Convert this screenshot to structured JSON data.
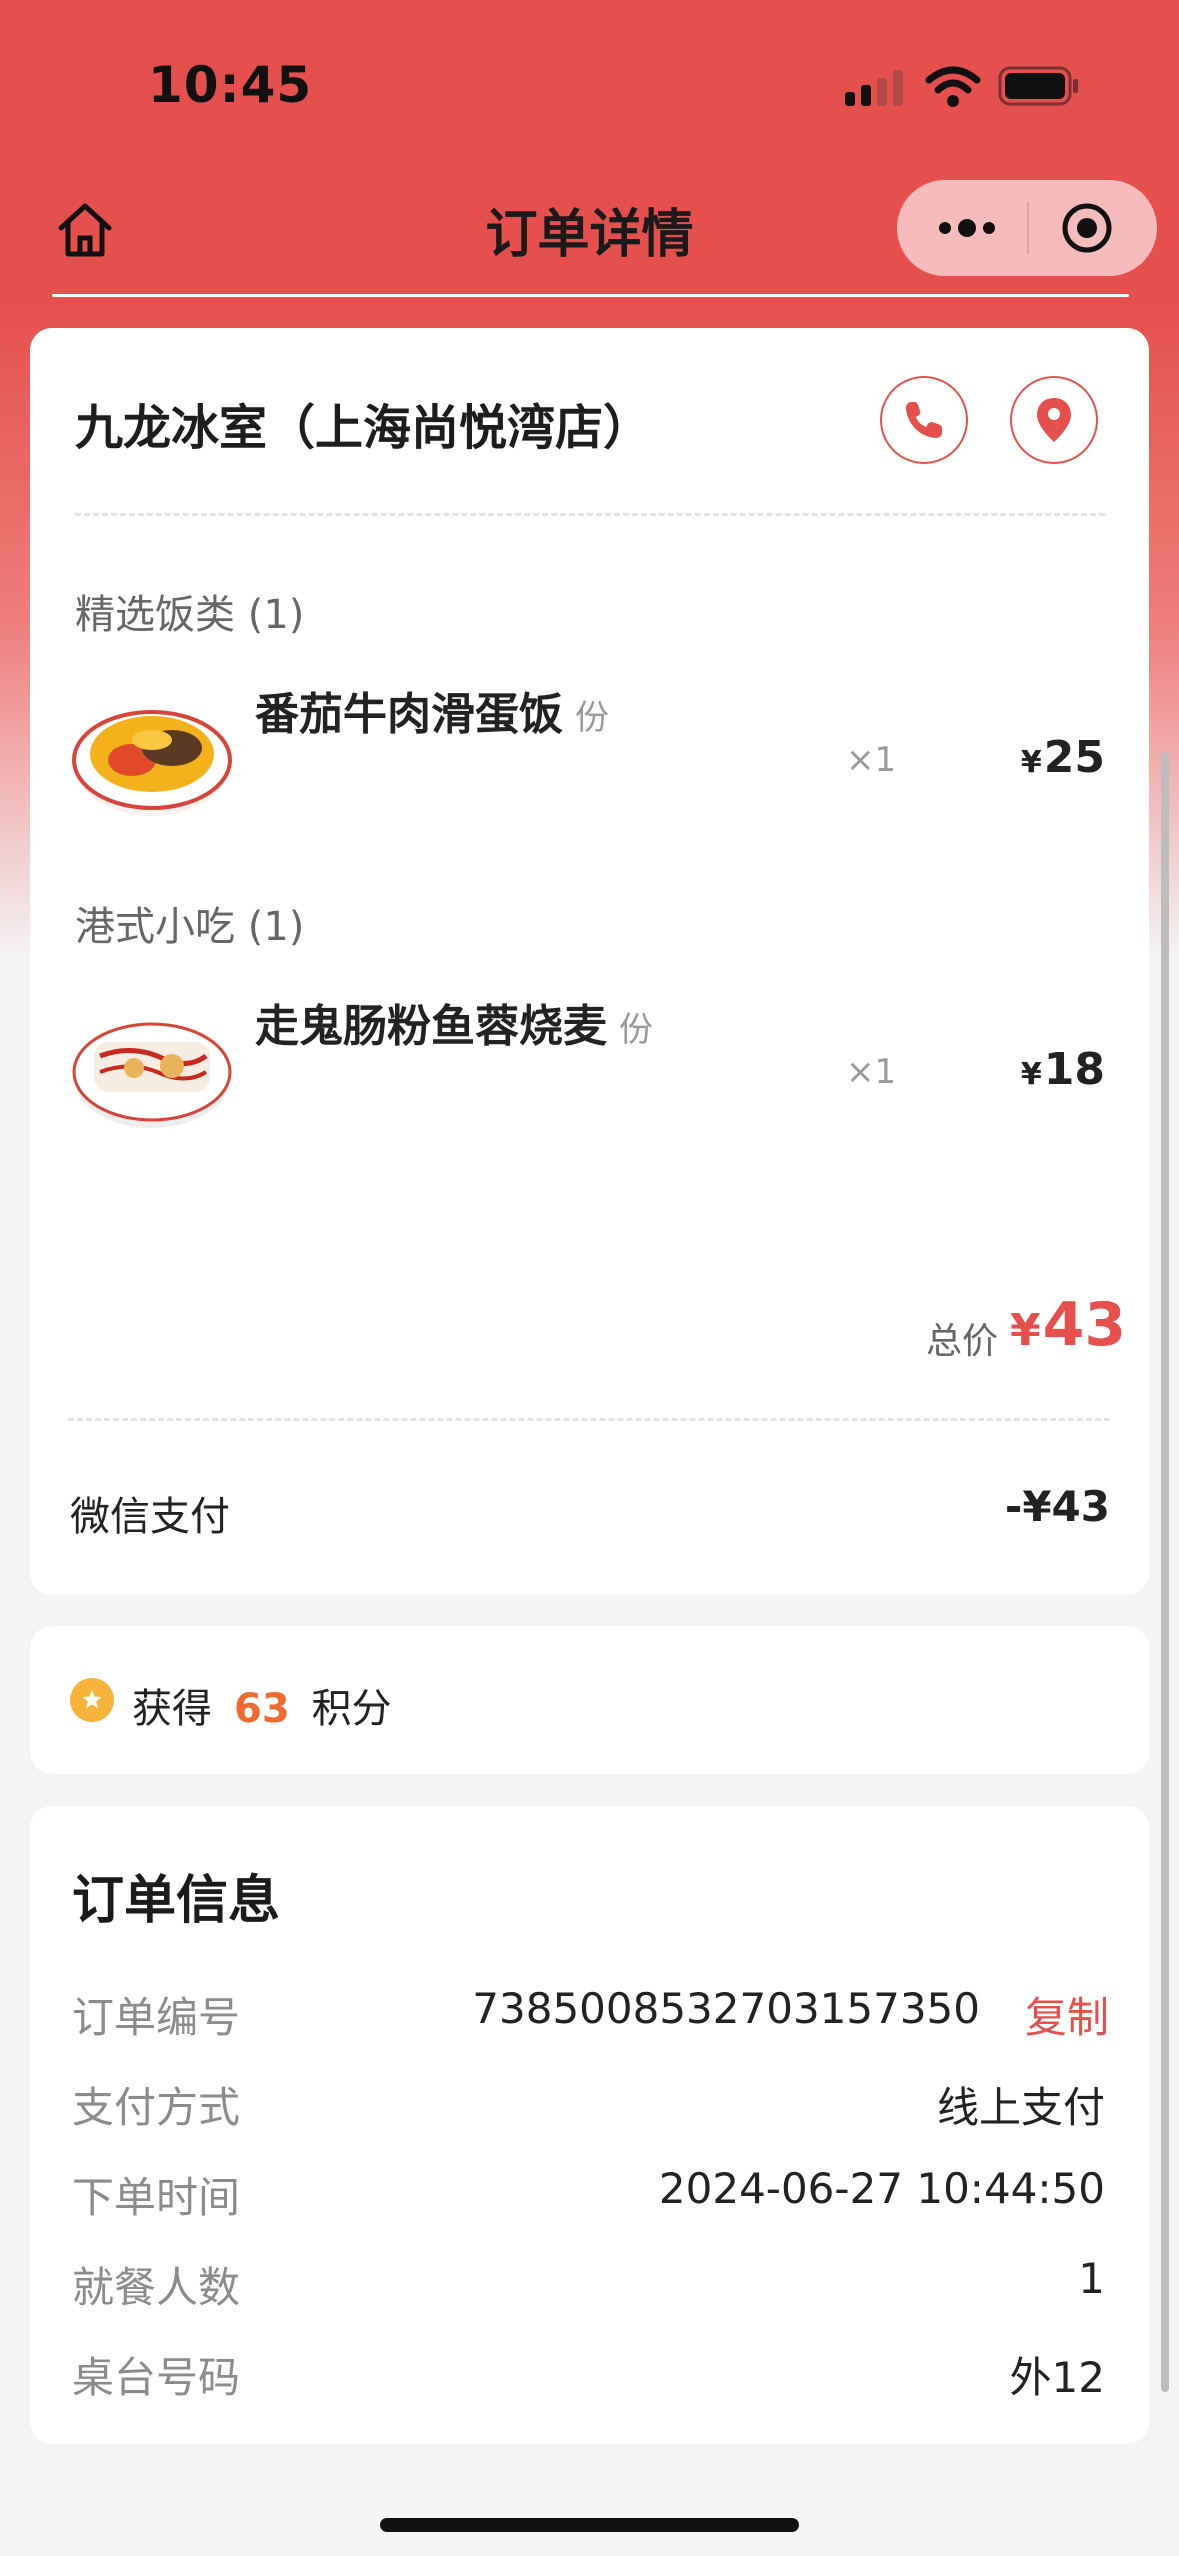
{
  "status_bar": {
    "time": "10:45"
  },
  "nav": {
    "title": "订单详情"
  },
  "store": {
    "name": "九龙冰室（上海尚悦湾店）"
  },
  "categories": [
    {
      "label": "精选饭类 (1)",
      "items": [
        {
          "name": "番茄牛肉滑蛋饭",
          "unit": "份",
          "qty": "×1",
          "currency": "¥",
          "price": "25"
        }
      ]
    },
    {
      "label": "港式小吃 (1)",
      "items": [
        {
          "name": "走鬼肠粉鱼蓉烧麦",
          "unit": "份",
          "qty": "×1",
          "currency": "¥",
          "price": "18"
        }
      ]
    }
  ],
  "total": {
    "label": "总价",
    "currency": "¥",
    "amount": "43"
  },
  "payment": {
    "label": "微信支付",
    "amount": "-¥43"
  },
  "points": {
    "prefix": "获得",
    "value": "63",
    "suffix": "积分"
  },
  "order_info": {
    "title": "订单信息",
    "copy_label": "复制",
    "rows": [
      {
        "label": "订单编号",
        "value": "7385008532703157350"
      },
      {
        "label": "支付方式",
        "value": "线上支付"
      },
      {
        "label": "下单时间",
        "value": "2024-06-27 10:44:50"
      },
      {
        "label": "就餐人数",
        "value": "1"
      },
      {
        "label": "桌台号码",
        "value": "外12"
      }
    ]
  },
  "colors": {
    "accent": "#e5504c",
    "points": "#ef6a2f",
    "coin": "#f6b33a"
  }
}
